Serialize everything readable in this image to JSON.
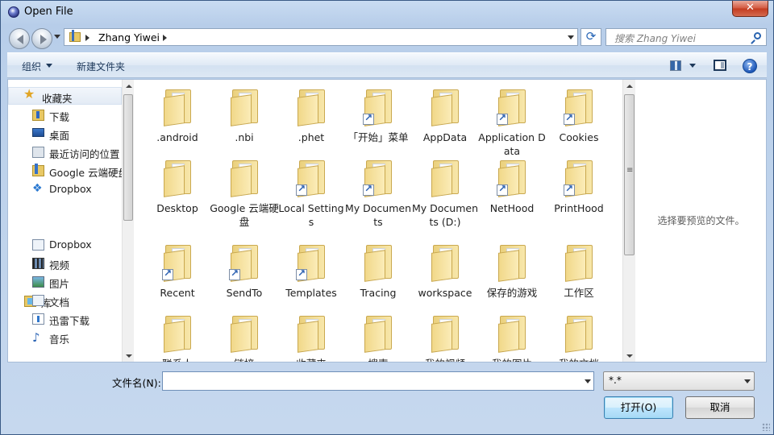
{
  "window": {
    "title": "Open File",
    "close_glyph": "✕"
  },
  "address": {
    "crumb": "Zhang Yiwei",
    "refresh_glyph": "⟳"
  },
  "search": {
    "placeholder": "搜索 Zhang Yiwei"
  },
  "toolbar": {
    "organize": "组织",
    "new_folder": "新建文件夹",
    "help_glyph": "?"
  },
  "nav": {
    "favorites": "收藏夹",
    "fav_items": [
      {
        "label": "下载",
        "icon": "download-folder-icon"
      },
      {
        "label": "桌面",
        "icon": "desktop-icon"
      },
      {
        "label": "最近访问的位置",
        "icon": "recent-places-icon"
      },
      {
        "label": "Google 云端硬盘",
        "icon": "google-drive-icon"
      },
      {
        "label": "Dropbox",
        "icon": "dropbox-icon"
      }
    ],
    "library": "库",
    "lib_items": [
      {
        "label": "Dropbox",
        "icon": "document-icon"
      },
      {
        "label": "视频",
        "icon": "video-icon"
      },
      {
        "label": "图片",
        "icon": "picture-icon"
      },
      {
        "label": "文档",
        "icon": "document-icon"
      },
      {
        "label": "迅雷下载",
        "icon": "thunder-download-icon"
      },
      {
        "label": "音乐",
        "icon": "music-icon"
      }
    ]
  },
  "files": [
    {
      "name": ".android",
      "shortcut": false
    },
    {
      "name": ".nbi",
      "shortcut": false
    },
    {
      "name": ".phet",
      "shortcut": false
    },
    {
      "name": "「开始」菜单",
      "shortcut": true
    },
    {
      "name": "AppData",
      "shortcut": false
    },
    {
      "name": "Application Data",
      "shortcut": true
    },
    {
      "name": "Cookies",
      "shortcut": true
    },
    {
      "name": "Desktop",
      "shortcut": false
    },
    {
      "name": "Google 云端硬盘",
      "shortcut": false
    },
    {
      "name": "Local Settings",
      "shortcut": true
    },
    {
      "name": "My Documents",
      "shortcut": true
    },
    {
      "name": "My Documents (D:)",
      "shortcut": false
    },
    {
      "name": "NetHood",
      "shortcut": true
    },
    {
      "name": "PrintHood",
      "shortcut": true
    },
    {
      "name": "Recent",
      "shortcut": true
    },
    {
      "name": "SendTo",
      "shortcut": true
    },
    {
      "name": "Templates",
      "shortcut": true
    },
    {
      "name": "Tracing",
      "shortcut": false
    },
    {
      "name": "workspace",
      "shortcut": false
    },
    {
      "name": "保存的游戏",
      "shortcut": false
    },
    {
      "name": "工作区",
      "shortcut": false
    },
    {
      "name": "联系人",
      "shortcut": false
    },
    {
      "name": "链接",
      "shortcut": false
    },
    {
      "name": "收藏夹",
      "shortcut": false
    },
    {
      "name": "搜索",
      "shortcut": false
    },
    {
      "name": "我的视频",
      "shortcut": false
    },
    {
      "name": "我的图片",
      "shortcut": false
    },
    {
      "name": "我的文档",
      "shortcut": false
    }
  ],
  "preview": {
    "message": "选择要预览的文件。"
  },
  "bottom": {
    "filename_label": "文件名(N):",
    "filename_value": "",
    "filetype": "*.*",
    "open": "打开(O)",
    "cancel": "取消"
  }
}
